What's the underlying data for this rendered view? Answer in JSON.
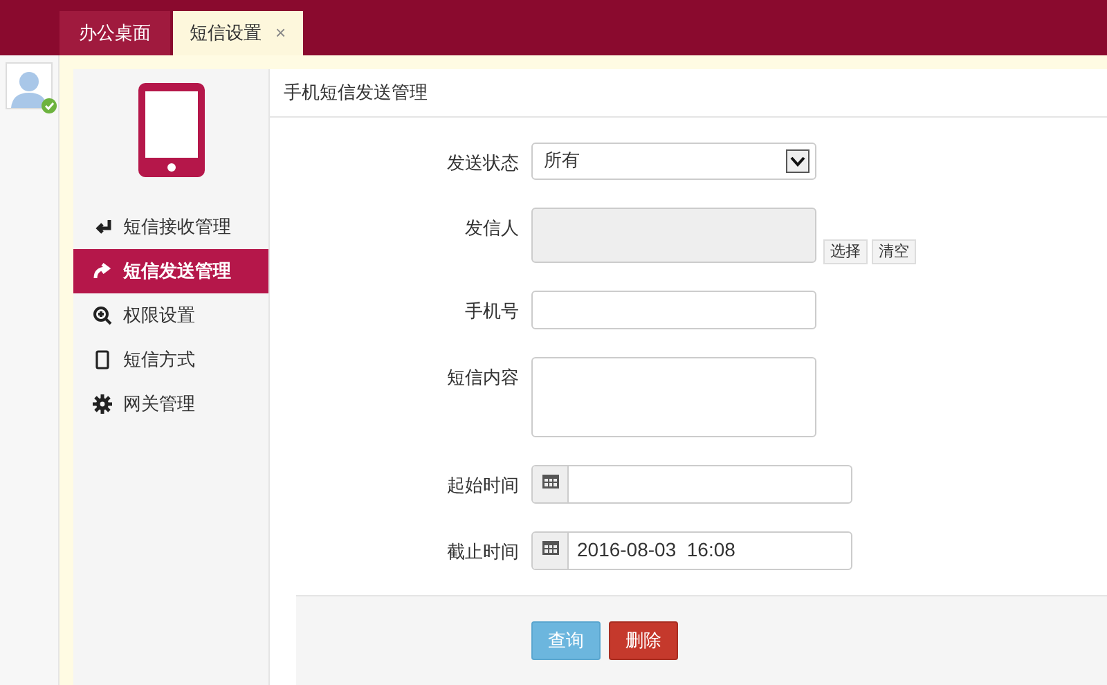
{
  "tabs": [
    {
      "label": "办公桌面",
      "selected": false
    },
    {
      "label": "短信设置",
      "selected": true,
      "close": "×"
    }
  ],
  "user": {
    "online": true
  },
  "sidebar": {
    "items": [
      {
        "label": "短信接收管理",
        "selected": false
      },
      {
        "label": "短信发送管理",
        "selected": true
      },
      {
        "label": "权限设置",
        "selected": false
      },
      {
        "label": "短信方式",
        "selected": false
      },
      {
        "label": "网关管理",
        "selected": false
      }
    ]
  },
  "panel_title": "手机短信发送管理",
  "form": [
    {
      "kind": "select",
      "label": "发送状态",
      "value": "所有"
    },
    {
      "kind": "picker",
      "label": "发信人",
      "buttons": [
        "选择",
        "清空"
      ]
    },
    {
      "kind": "text",
      "label": "手机号"
    },
    {
      "kind": "textarea",
      "label": "短信内容"
    },
    {
      "kind": "date",
      "label": "起始时间"
    },
    {
      "kind": "date",
      "label": "截止时间",
      "value": "2016-08-03  16:08"
    }
  ],
  "actions": [
    {
      "label": "查询",
      "kind": "primary"
    },
    {
      "label": "删除",
      "kind": "danger"
    }
  ]
}
